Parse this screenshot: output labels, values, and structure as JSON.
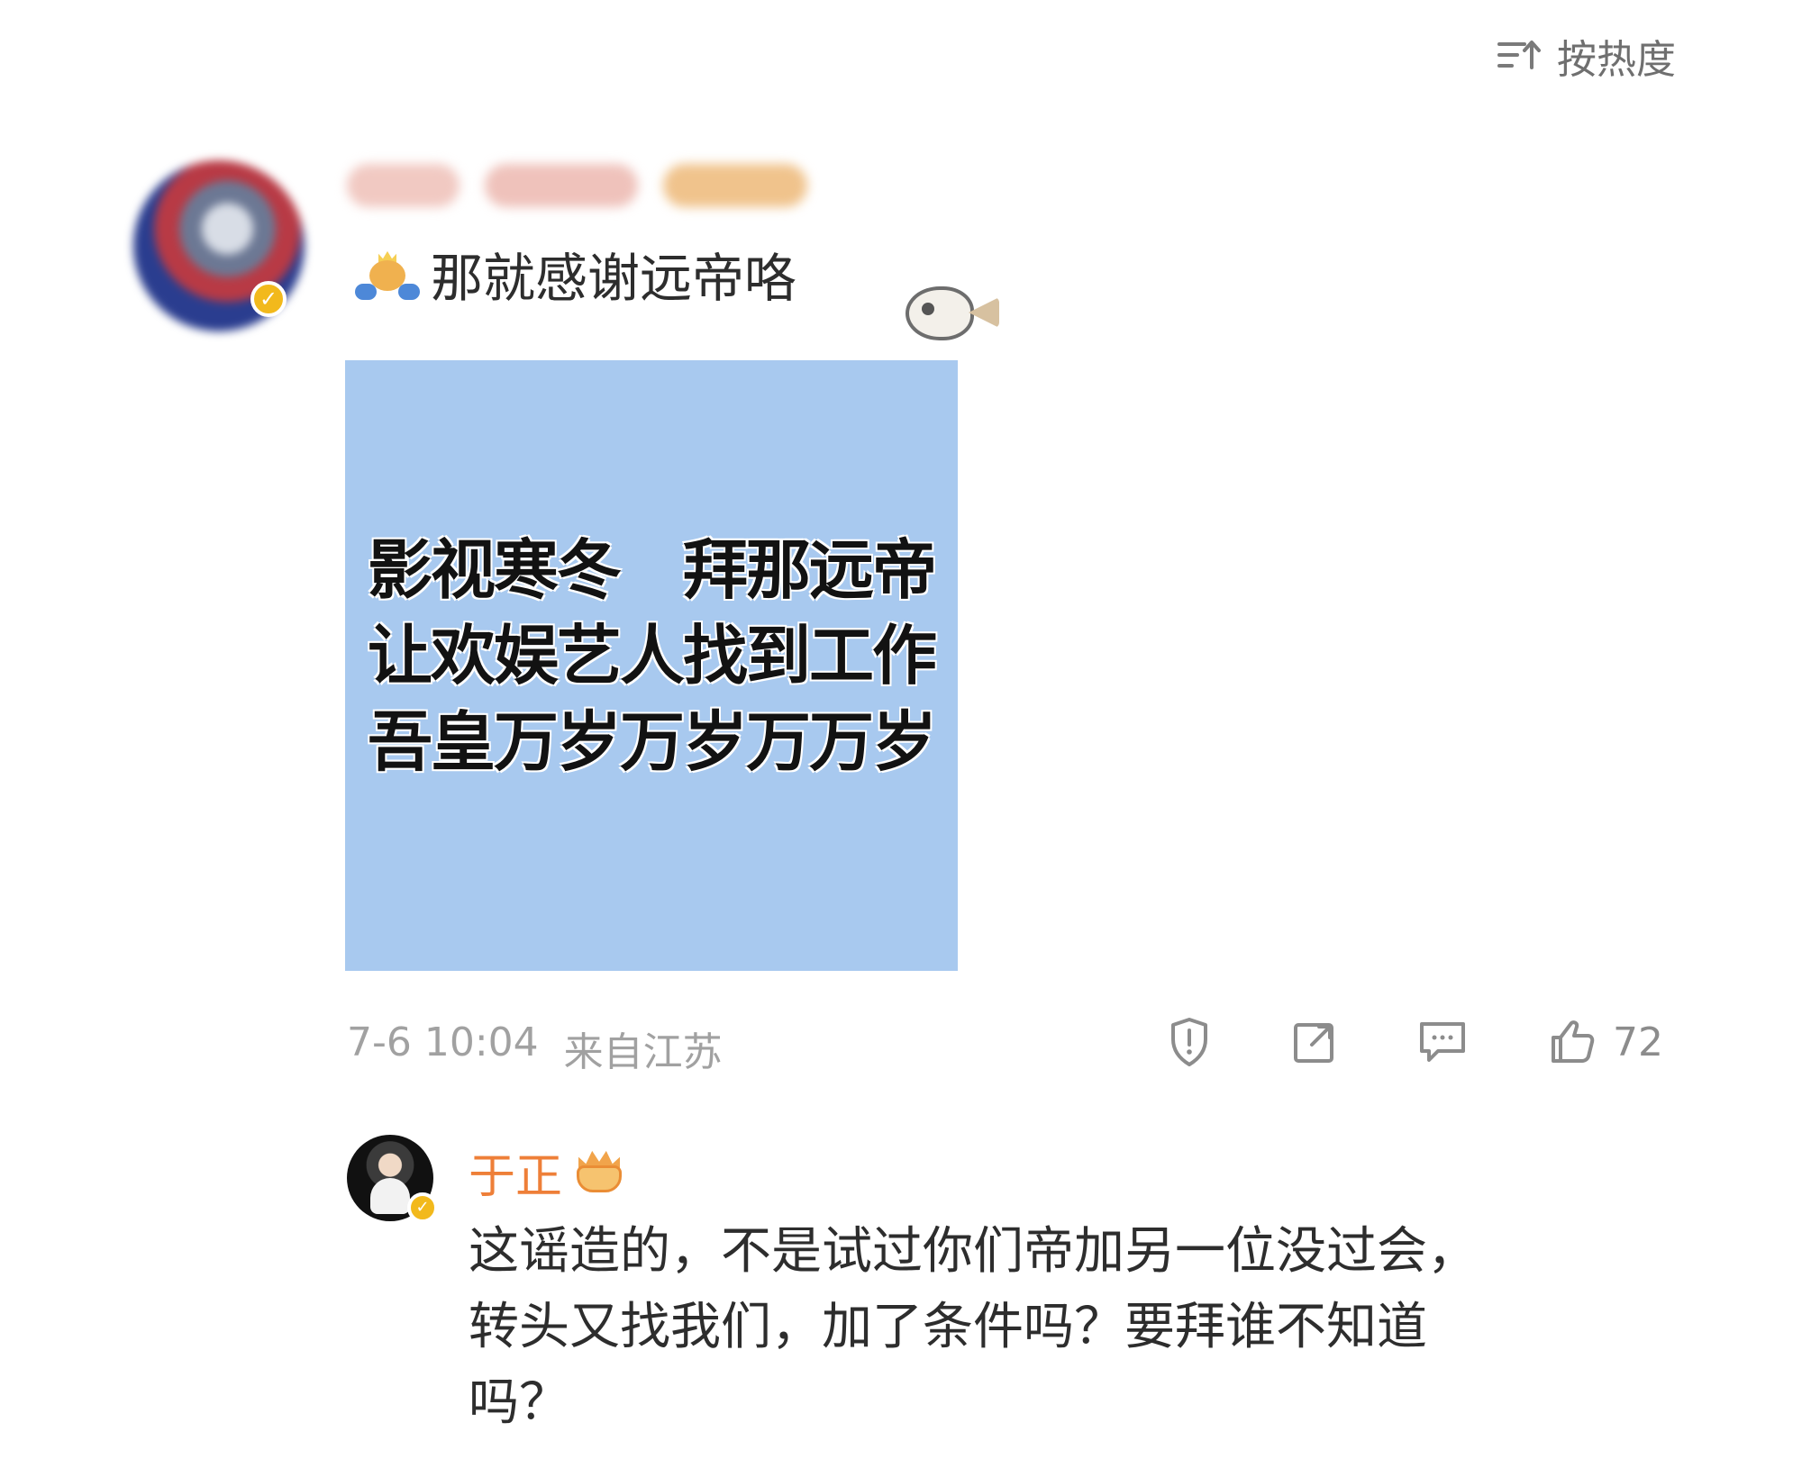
{
  "sort": {
    "label": "按热度",
    "icon": "sort-icon"
  },
  "comment": {
    "text": "那就感谢远帝咯",
    "leading_emoji": "bear-crown-emoji",
    "trailing_sticker": "fish-sticker",
    "image_text": [
      "影视寒冬　拜那远帝",
      "让欢娱艺人找到工作",
      "吾皇万岁万岁万万岁"
    ],
    "time": "7-6 10:04",
    "location": "来自江苏",
    "likes": "72",
    "actions": [
      {
        "name": "report",
        "icon": "report-icon"
      },
      {
        "name": "share",
        "icon": "share-icon"
      },
      {
        "name": "reply",
        "icon": "comment-icon"
      },
      {
        "name": "like",
        "icon": "like-icon"
      }
    ]
  },
  "reply": {
    "name": "于正",
    "text": "这谣造的，不是试过你们帝加另一位没过会，\n转头又找我们，加了条件吗？要拜谁不知道\n吗？",
    "badge_icon": "crown-badge-icon"
  }
}
